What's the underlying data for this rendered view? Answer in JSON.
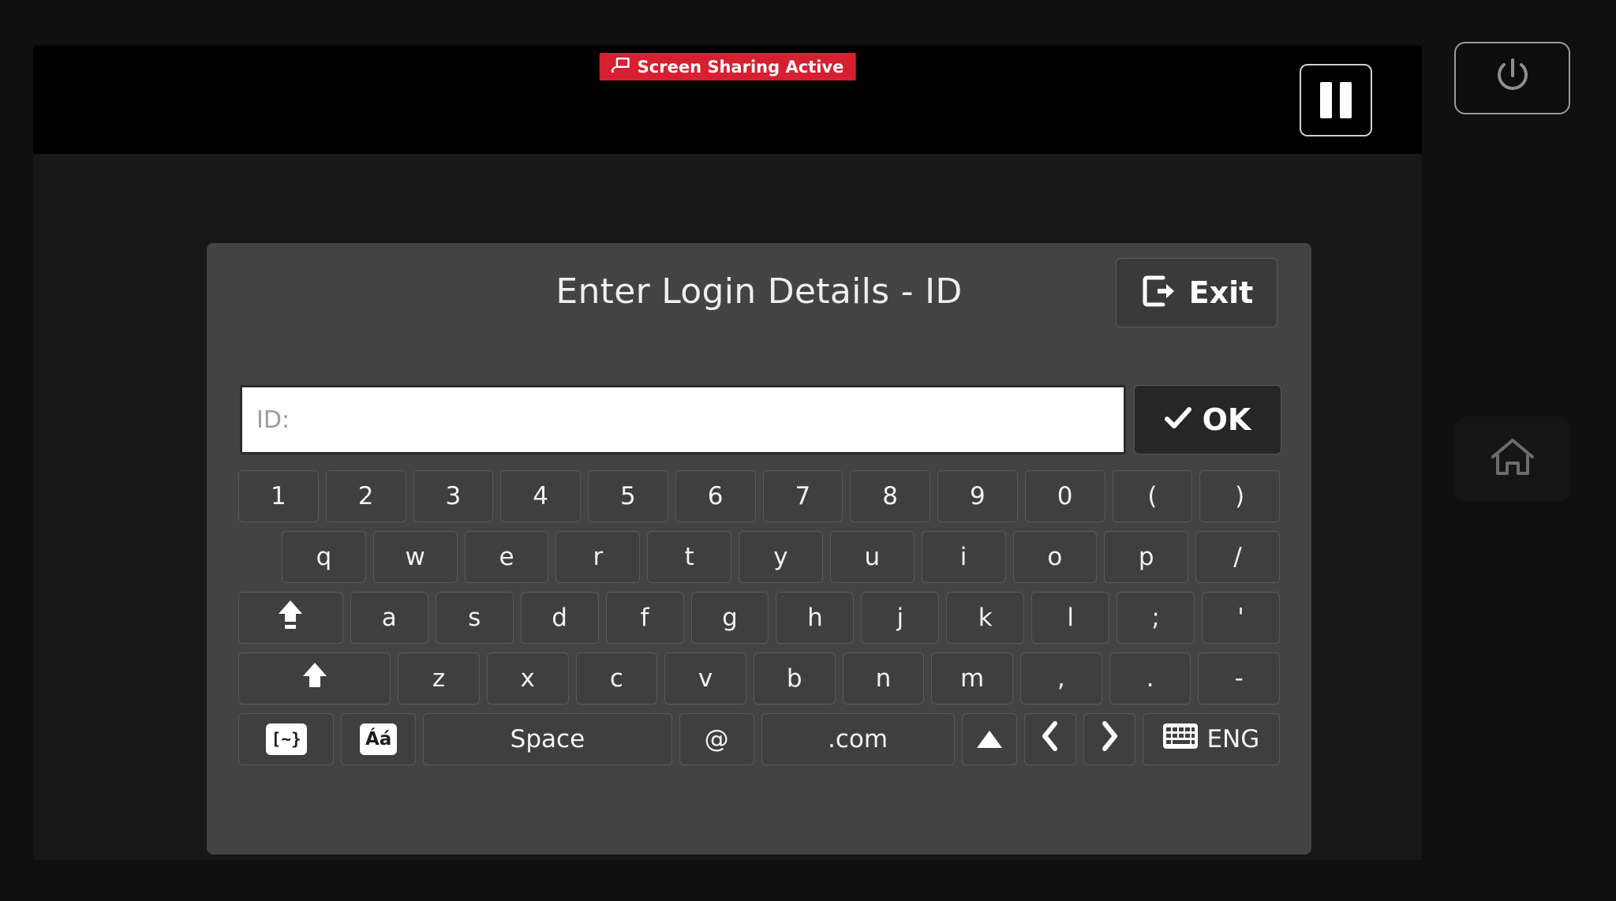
{
  "status_bar": {
    "sharing_badge_label": "Screen Sharing Active",
    "sharing_badge_icon": "screen-share-icon",
    "sharing_badge_color": "#d81f32",
    "pause_button_icon": "pause-icon"
  },
  "right_rail": {
    "power_button_icon": "power-icon",
    "home_button_icon": "home-icon"
  },
  "dialog": {
    "title": "Enter Login Details - ID",
    "exit_label": "Exit",
    "exit_icon": "sign-out-icon",
    "input": {
      "placeholder": "ID:",
      "value": ""
    },
    "ok_label": "OK",
    "ok_icon": "check-icon"
  },
  "keyboard": {
    "rows": [
      {
        "name": "number-row",
        "keys": [
          {
            "label": "1"
          },
          {
            "label": "2"
          },
          {
            "label": "3"
          },
          {
            "label": "4"
          },
          {
            "label": "5"
          },
          {
            "label": "6"
          },
          {
            "label": "7"
          },
          {
            "label": "8"
          },
          {
            "label": "9"
          },
          {
            "label": "0"
          },
          {
            "label": "("
          },
          {
            "label": ")"
          }
        ]
      },
      {
        "name": "top-letter-row",
        "keys": [
          {
            "label": "q"
          },
          {
            "label": "w"
          },
          {
            "label": "e"
          },
          {
            "label": "r"
          },
          {
            "label": "t"
          },
          {
            "label": "y"
          },
          {
            "label": "u"
          },
          {
            "label": "i"
          },
          {
            "label": "o"
          },
          {
            "label": "p"
          },
          {
            "label": "/"
          }
        ]
      },
      {
        "name": "home-letter-row",
        "keys": [
          {
            "label": "",
            "icon": "caps-lock-icon"
          },
          {
            "label": "a"
          },
          {
            "label": "s"
          },
          {
            "label": "d"
          },
          {
            "label": "f"
          },
          {
            "label": "g"
          },
          {
            "label": "h"
          },
          {
            "label": "j"
          },
          {
            "label": "k"
          },
          {
            "label": "l"
          },
          {
            "label": ";"
          },
          {
            "label": "'"
          }
        ]
      },
      {
        "name": "bottom-letter-row",
        "keys": [
          {
            "label": "",
            "icon": "shift-icon"
          },
          {
            "label": "z"
          },
          {
            "label": "x"
          },
          {
            "label": "c"
          },
          {
            "label": "v"
          },
          {
            "label": "b"
          },
          {
            "label": "n"
          },
          {
            "label": "m"
          },
          {
            "label": ","
          },
          {
            "label": "."
          },
          {
            "label": "-"
          }
        ]
      },
      {
        "name": "function-row",
        "keys": [
          {
            "label": "[~}",
            "icon": "symbols-key-icon"
          },
          {
            "label": "Áá",
            "icon": "accents-key-icon"
          },
          {
            "label": "Space"
          },
          {
            "label": "@"
          },
          {
            "label": ".com"
          },
          {
            "label": "",
            "icon": "triangle-up-icon"
          },
          {
            "label": "‹",
            "icon": "chevron-left-icon"
          },
          {
            "label": "›",
            "icon": "chevron-right-icon"
          },
          {
            "label": "ENG",
            "icon": "keyboard-icon"
          }
        ]
      }
    ]
  }
}
